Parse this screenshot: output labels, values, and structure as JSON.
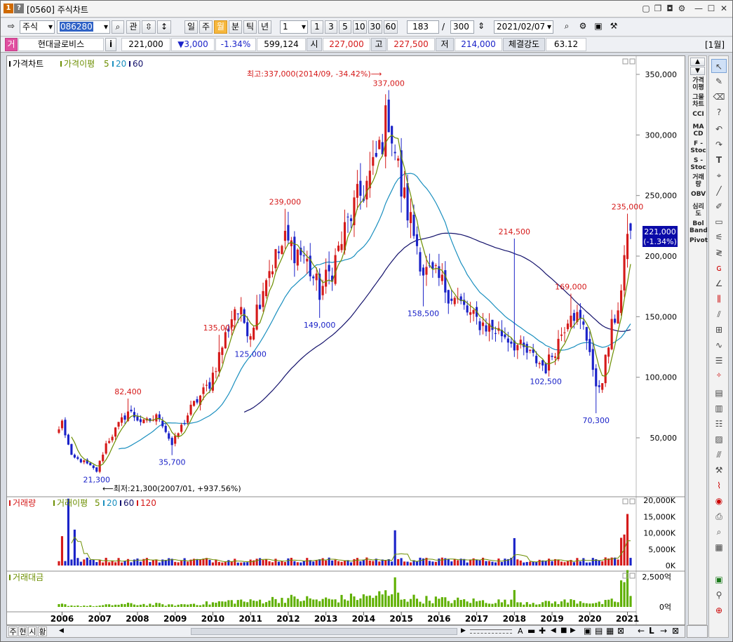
{
  "window": {
    "num_badge": "1",
    "help_badge": "?",
    "title": "[0560] 주식차트"
  },
  "toolbar1": {
    "market": "주식",
    "code": "086280",
    "btn_gwan": "관",
    "periods": [
      "일",
      "주",
      "월",
      "분",
      "틱",
      "년"
    ],
    "active_period": "월",
    "interval_value": "1",
    "interval_buttons": [
      "1",
      "3",
      "5",
      "10",
      "30",
      "60"
    ],
    "count_shown": "183",
    "count_sep": "/",
    "count_total": "300",
    "date": "2021/02/07"
  },
  "toolbar2": {
    "type_badge": "거",
    "name": "현대글로비스",
    "info": "i",
    "price": "221,000",
    "change": "▼3,000",
    "change_pct": "-1.34%",
    "volume": "599,124",
    "open_label": "시",
    "open": "227,000",
    "high_label": "고",
    "high": "227,500",
    "low_label": "저",
    "low": "214,000",
    "strength_label": "체결강도",
    "strength": "63.12",
    "period_tag": "[1월]"
  },
  "colors": {
    "up": "#d51a1a",
    "down": "#1a22c8",
    "ma5": "#6c8e00",
    "ma20": "#1a8fbf",
    "ma60": "#13116b",
    "accent": "#0a0aa8"
  },
  "price_panel": {
    "legend_title": "가격차트",
    "legend_ma": "가격이평",
    "legend_p1": "5",
    "legend_p2": "20",
    "legend_p3": "60",
    "max_note": "최고:337,000(2014/09, -34.42%)⟶",
    "min_note": "⟵최저:21,300(2007/01, +937.56%)",
    "last_box_1": "221,000",
    "last_box_2": "(-1.34%)"
  },
  "volume_panel": {
    "legend_title": "거래량",
    "legend_ma": "거래이평",
    "p1": "5",
    "p2": "20",
    "p3": "60",
    "p4": "120"
  },
  "amount_panel": {
    "legend_title": "거래대금"
  },
  "indicators": [
    "가격\n이평",
    "그물\n차트",
    "CCI",
    "MA\nCD",
    "F -\nStoc",
    "S -\nStoc",
    "거래\n량",
    "OBV",
    "심리\n도",
    "Bol\nBand",
    "Pivot"
  ],
  "bottom": {
    "tabs": [
      "주",
      "현",
      "시",
      "황"
    ]
  },
  "chart_data": [
    {
      "type": "candlestick",
      "title": "가격차트",
      "x_unit": "month",
      "xlim": [
        "2005-12",
        "2021-02"
      ],
      "ylim": [
        0,
        360000
      ],
      "yticks": [
        50000,
        100000,
        150000,
        200000,
        250000,
        300000,
        350000
      ],
      "ytick_labels": [
        "50,000",
        "100,000",
        "150,000",
        "200,000",
        "250,000",
        "300,000",
        "350,000"
      ],
      "xticks": [
        "2006",
        "2007",
        "2008",
        "2009",
        "2010",
        "2011",
        "2012",
        "2013",
        "2014",
        "2015",
        "2016",
        "2017",
        "2018",
        "2019",
        "2020",
        "2021"
      ],
      "annotations": [
        {
          "date": "2006-12",
          "value": 21300,
          "label": "21,300",
          "color": "down"
        },
        {
          "date": "2007-10",
          "value": 82400,
          "label": "82,400",
          "color": "up"
        },
        {
          "date": "2008-12",
          "value": 35700,
          "label": "35,700",
          "color": "down"
        },
        {
          "date": "2010-03",
          "value": 135000,
          "label": "135,000",
          "color": "up"
        },
        {
          "date": "2011-01",
          "value": 125000,
          "label": "125,000",
          "color": "down"
        },
        {
          "date": "2011-12",
          "value": 239000,
          "label": "239,000",
          "color": "up"
        },
        {
          "date": "2012-11",
          "value": 149000,
          "label": "149,000",
          "color": "down"
        },
        {
          "date": "2014-09",
          "value": 337000,
          "label": "337,000",
          "color": "up"
        },
        {
          "date": "2015-08",
          "value": 158500,
          "label": "158,500",
          "color": "down"
        },
        {
          "date": "2018-01",
          "value": 214500,
          "label": "214,500",
          "color": "up"
        },
        {
          "date": "2018-11",
          "value": 102500,
          "label": "102,500",
          "color": "down"
        },
        {
          "date": "2019-07",
          "value": 169000,
          "label": "169,000",
          "color": "up"
        },
        {
          "date": "2020-03",
          "value": 70300,
          "label": "70,300",
          "color": "down"
        },
        {
          "date": "2021-01",
          "value": 235000,
          "label": "235,000",
          "color": "up"
        }
      ],
      "anchors": [
        [
          "2005-12",
          57000
        ],
        [
          "2006-01",
          63000
        ],
        [
          "2006-04",
          34000
        ],
        [
          "2006-08",
          30000
        ],
        [
          "2006-12",
          22500
        ],
        [
          "2007-03",
          45000
        ],
        [
          "2007-10",
          72000
        ],
        [
          "2008-03",
          62000
        ],
        [
          "2008-08",
          68000
        ],
        [
          "2008-12",
          44000
        ],
        [
          "2009-06",
          74000
        ],
        [
          "2009-12",
          95000
        ],
        [
          "2010-03",
          118000
        ],
        [
          "2010-08",
          158000
        ],
        [
          "2011-01",
          138000
        ],
        [
          "2011-06",
          185000
        ],
        [
          "2011-12",
          212000
        ],
        [
          "2012-06",
          200000
        ],
        [
          "2012-11",
          170000
        ],
        [
          "2013-03",
          190000
        ],
        [
          "2013-09",
          235000
        ],
        [
          "2014-04",
          270000
        ],
        [
          "2014-09",
          318000
        ],
        [
          "2015-01",
          255000
        ],
        [
          "2015-06",
          210000
        ],
        [
          "2015-08",
          188000
        ],
        [
          "2016-01",
          180000
        ],
        [
          "2016-06",
          165000
        ],
        [
          "2016-12",
          148000
        ],
        [
          "2017-06",
          140000
        ],
        [
          "2017-10",
          135000
        ],
        [
          "2018-01",
          128000
        ],
        [
          "2018-06",
          118000
        ],
        [
          "2018-11",
          108000
        ],
        [
          "2019-03",
          130000
        ],
        [
          "2019-07",
          158000
        ],
        [
          "2019-11",
          140000
        ],
        [
          "2020-01",
          125000
        ],
        [
          "2020-03",
          88000
        ],
        [
          "2020-05",
          100000
        ],
        [
          "2020-08",
          140000
        ],
        [
          "2020-11",
          170000
        ],
        [
          "2020-12",
          190000
        ],
        [
          "2021-01",
          225000
        ],
        [
          "2021-02",
          221000
        ]
      ]
    },
    {
      "type": "bar",
      "title": "거래량",
      "ylim": [
        0,
        22000
      ],
      "unit": "K",
      "yticks": [
        0,
        5000,
        10000,
        15000,
        20000
      ],
      "ytick_labels": [
        "0K",
        "5,000K",
        "10,000K",
        "15,000K",
        "20,000K"
      ],
      "spikes": [
        [
          "2006-01",
          9000
        ],
        [
          "2006-03",
          20500
        ],
        [
          "2006-05",
          11000
        ],
        [
          "2014-11",
          10800
        ],
        [
          "2018-01",
          8400
        ],
        [
          "2020-11",
          8500
        ],
        [
          "2020-12",
          9500
        ],
        [
          "2021-01",
          15800
        ]
      ]
    },
    {
      "type": "bar",
      "title": "거래대금",
      "ylim": [
        0,
        3200
      ],
      "unit": "억",
      "yticks": [
        0,
        2500
      ],
      "ytick_labels": [
        "0억",
        "2,500억"
      ],
      "spikes": [
        [
          "2014-11",
          2450
        ],
        [
          "2018-01",
          1400
        ],
        [
          "2020-11",
          2200
        ],
        [
          "2020-12",
          2050
        ],
        [
          "2021-01",
          3050
        ]
      ]
    }
  ]
}
